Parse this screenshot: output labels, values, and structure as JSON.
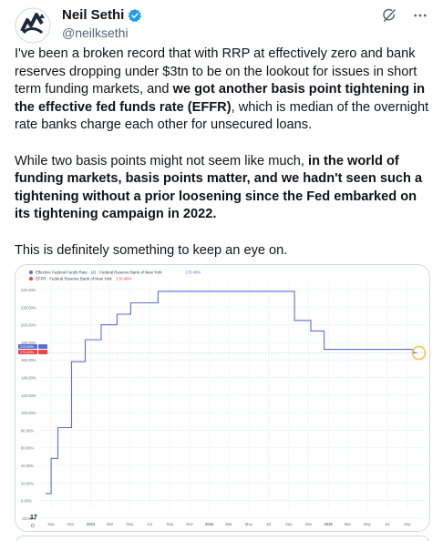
{
  "author": {
    "display_name": "Neil Sethi",
    "handle": "@neilksethi"
  },
  "icons": {
    "avatar": "logo-avatar",
    "verified": "verified-badge-icon",
    "grok": "grok-icon",
    "more": "more-icon"
  },
  "colors": {
    "accent": "#1d9bf0",
    "text": "#0f1419",
    "muted": "#536471",
    "effr_line": "#5b6fd6",
    "highlight": "#f2c94c"
  },
  "post": {
    "p1_a": "I've been a broken record that with RRP at effectively zero and bank reserves dropping under $3tn to be on the lookout for issues in short term funding markets, and ",
    "p1_b": "we got another basis point tightening in the effective fed funds rate (EFFR)",
    "p1_c": ", which is median of the overnight rate banks charge each other for unsecured loans.",
    "p2_a": "While two basis points might not seem like much, ",
    "p2_b": "in the world of funding markets, basis points matter, and we hadn't seen such a tightening without a prior loosening since the Fed embarked on its tightening campaign in 2022.",
    "p3": "This is definitely something to keep an eye on."
  },
  "chart_data": {
    "type": "line",
    "title": "Effective Federal Funds Rate · 1D · Federal Reserve Bank of New York",
    "title_value": "170.49%",
    "legend": [
      {
        "name": "EFFR · Federal Reserve Bank of New York",
        "value": "170.49%"
      }
    ],
    "price_badges": [
      "170.49%",
      "170.49%"
    ],
    "y_ticks": [
      "240.00%",
      "220.00%",
      "200.00%",
      "180.00%",
      "160.00%",
      "140.00%",
      "120.00%",
      "100.00%",
      "80.00%",
      "60.00%",
      "40.00%",
      "20.00%",
      "0.00%",
      "-20.00%"
    ],
    "x_ticks": [
      "Sep",
      "Nov",
      "2023",
      "Mar",
      "May",
      "Jul",
      "Sep",
      "Nov",
      "2024",
      "Mar",
      "May",
      "Jul",
      "Sep",
      "Nov",
      "2025",
      "Mar",
      "May",
      "Jul",
      "Sep"
    ],
    "ylim": [
      -20,
      250
    ],
    "grid": true,
    "series": [
      {
        "name": "EFFR",
        "points": [
          [
            "2022-08-15",
            0.08
          ],
          [
            "2022-09-01",
            0.08
          ],
          [
            "2022-09-01",
            0.48
          ],
          [
            "2022-09-22",
            0.48
          ],
          [
            "2022-09-22",
            0.83
          ],
          [
            "2022-11-03",
            0.83
          ],
          [
            "2022-11-03",
            1.58
          ],
          [
            "2022-12-15",
            1.58
          ],
          [
            "2022-12-15",
            1.83
          ],
          [
            "2023-02-02",
            1.83
          ],
          [
            "2023-02-02",
            2.0
          ],
          [
            "2023-03-23",
            2.0
          ],
          [
            "2023-03-23",
            2.12
          ],
          [
            "2023-05-04",
            2.12
          ],
          [
            "2023-05-04",
            2.25
          ],
          [
            "2023-07-27",
            2.25
          ],
          [
            "2023-07-27",
            2.38
          ],
          [
            "2024-09-19",
            2.38
          ],
          [
            "2024-09-19",
            2.05
          ],
          [
            "2024-11-08",
            2.05
          ],
          [
            "2024-11-08",
            1.93
          ],
          [
            "2024-12-19",
            1.93
          ],
          [
            "2024-12-19",
            1.72
          ],
          [
            "2025-09-20",
            1.72
          ],
          [
            "2025-09-20",
            1.68
          ],
          [
            "2025-10-01",
            1.68
          ]
        ]
      }
    ]
  }
}
